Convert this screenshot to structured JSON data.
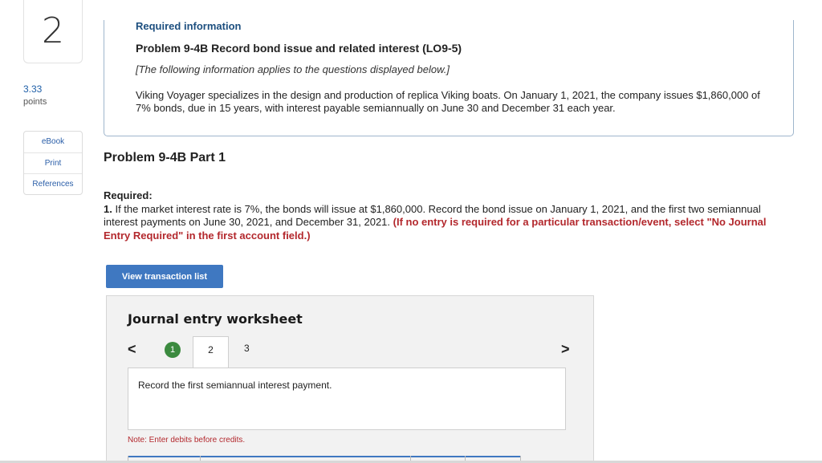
{
  "question": {
    "number": "2",
    "points_value": "3.33",
    "points_label": "points"
  },
  "side_menu": {
    "ebook": "eBook",
    "print": "Print",
    "references": "References"
  },
  "info": {
    "kicker": "Required information",
    "title": "Problem 9-4B Record bond issue and related interest (LO9-5)",
    "note": "[The following information applies to the questions displayed below.]",
    "body": "Viking Voyager specializes in the design and production of replica Viking boats. On January 1, 2021, the company issues $1,860,000 of 7% bonds, due in 15 years, with interest payable semiannually on June 30 and December 31 each year."
  },
  "part_title": "Problem 9-4B Part 1",
  "required": {
    "label": "Required:",
    "num": "1.",
    "text": " If the market interest rate is 7%, the bonds will issue at $1,860,000. Record the bond issue on January 1, 2021, and the first two semiannual interest payments on June 30, 2021, and December 31, 2021. ",
    "red": "(If no entry is required for a particular transaction/event, select \"No Journal Entry Required\" in the first account field.)"
  },
  "view_transaction_label": "View transaction list",
  "worksheet": {
    "title": "Journal entry worksheet",
    "prev": "<",
    "next": ">",
    "steps": [
      "1",
      "2",
      "3"
    ],
    "instruction": "Record the first semiannual interest payment.",
    "note": "Note: Enter debits before credits."
  },
  "colors": {
    "accent_blue": "#3f78c1",
    "link_blue": "#2a5ea8",
    "alert_red": "#b3282d",
    "step_green": "#3b8a3f"
  }
}
